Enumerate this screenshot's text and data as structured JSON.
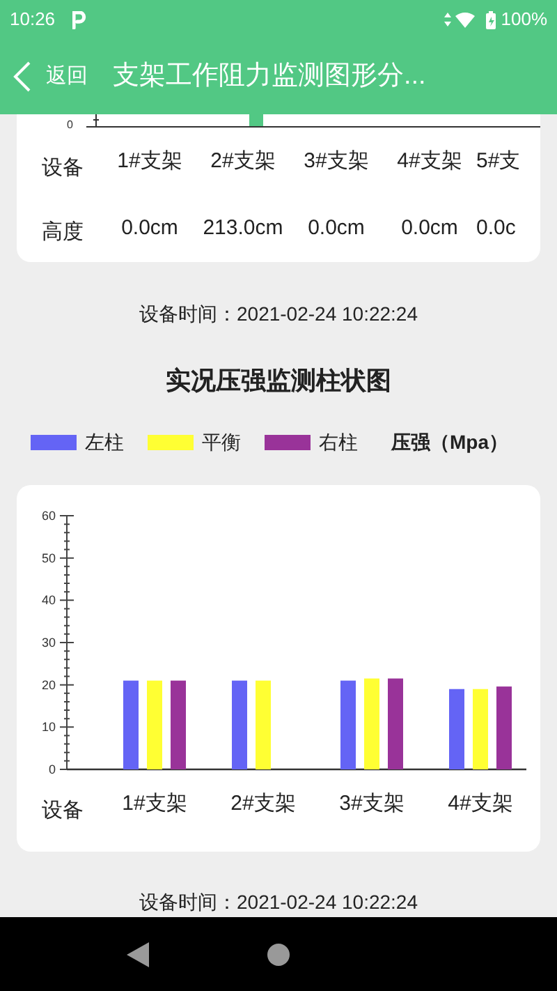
{
  "status_bar": {
    "time": "10:26",
    "battery": "100%"
  },
  "header": {
    "back_label": "返回",
    "title": "支架工作阻力监测图形分..."
  },
  "top_card": {
    "axis_tick": "0",
    "rows": [
      {
        "label": "设备",
        "cells": [
          "1#支架",
          "2#支架",
          "3#支架",
          "4#支架",
          "5#支"
        ]
      },
      {
        "label": "高度",
        "cells": [
          "0.0cm",
          "213.0cm",
          "0.0cm",
          "0.0cm",
          "0.0c"
        ]
      }
    ]
  },
  "device_time_1": "设备时间：2021-02-24 10:22:24",
  "pressure_chart": {
    "chart_data": {
      "type": "bar",
      "title": "实况压强监测柱状图",
      "xlabel": "设备",
      "ylabel": "压强（Mpa）",
      "categories": [
        "1#支架",
        "2#支架",
        "3#支架",
        "4#支架"
      ],
      "series": [
        {
          "name": "左柱",
          "color": "#6464f5",
          "values": [
            21,
            21,
            21,
            19
          ]
        },
        {
          "name": "平衡",
          "color": "#ffff33",
          "values": [
            21,
            21,
            21.5,
            19
          ]
        },
        {
          "name": "右柱",
          "color": "#993399",
          "values": [
            21,
            null,
            21.5,
            19.6
          ]
        }
      ],
      "ylim": [
        0,
        60
      ],
      "yticks": [
        0,
        10,
        20,
        30,
        40,
        50,
        60
      ],
      "legend": "top"
    }
  },
  "device_time_2": "设备时间：2021-02-24 10:22:24"
}
